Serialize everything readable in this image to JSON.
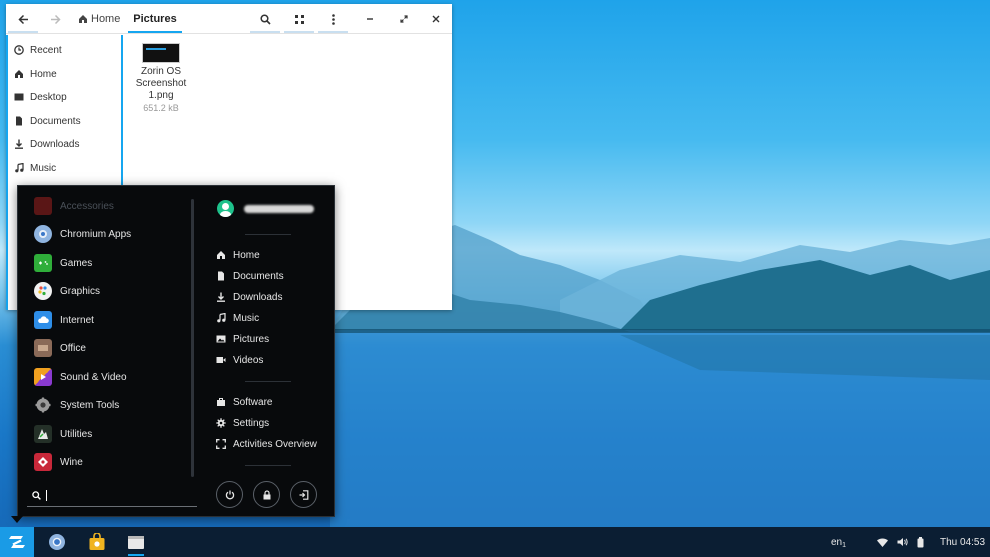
{
  "file_manager": {
    "breadcrumb": {
      "home": "Home",
      "current": "Pictures"
    },
    "sidebar": [
      {
        "label": "Recent",
        "icon": "clock-icon"
      },
      {
        "label": "Home",
        "icon": "home-icon"
      },
      {
        "label": "Desktop",
        "icon": "desktop-icon"
      },
      {
        "label": "Documents",
        "icon": "document-icon"
      },
      {
        "label": "Downloads",
        "icon": "download-icon"
      },
      {
        "label": "Music",
        "icon": "music-icon"
      }
    ],
    "file": {
      "name_line1": "Zorin OS",
      "name_line2": "Screenshot",
      "name_line3": "1.png",
      "size": "651.2 kB"
    }
  },
  "menu": {
    "categories": [
      {
        "label": "Accessories",
        "icon": "accessories-icon",
        "color": "#b02a2a"
      },
      {
        "label": "Chromium Apps",
        "icon": "chromium-icon",
        "color": "#8fb4e0"
      },
      {
        "label": "Games",
        "icon": "games-icon",
        "color": "#2fae3a"
      },
      {
        "label": "Graphics",
        "icon": "graphics-icon",
        "color": "#f2f2f2"
      },
      {
        "label": "Internet",
        "icon": "internet-icon",
        "color": "#2e8ee8"
      },
      {
        "label": "Office",
        "icon": "office-icon",
        "color": "#8a6a58"
      },
      {
        "label": "Sound & Video",
        "icon": "sound-video-icon",
        "color": "#f0a020"
      },
      {
        "label": "System Tools",
        "icon": "system-tools-icon",
        "color": "#9a9a9a"
      },
      {
        "label": "Utilities",
        "icon": "utilities-icon",
        "color": "#3a4a40"
      },
      {
        "label": "Wine",
        "icon": "wine-icon",
        "color": "#c8283a"
      }
    ],
    "places": [
      {
        "label": "Home",
        "icon": "home-icon"
      },
      {
        "label": "Documents",
        "icon": "document-icon"
      },
      {
        "label": "Downloads",
        "icon": "download-icon"
      },
      {
        "label": "Music",
        "icon": "music-icon"
      },
      {
        "label": "Pictures",
        "icon": "picture-icon"
      },
      {
        "label": "Videos",
        "icon": "video-icon"
      }
    ],
    "system": [
      {
        "label": "Software",
        "icon": "software-icon"
      },
      {
        "label": "Settings",
        "icon": "settings-icon"
      },
      {
        "label": "Activities Overview",
        "icon": "activities-icon"
      }
    ]
  },
  "taskbar": {
    "keyboard_layout": "en",
    "keyboard_layout_sub": "1",
    "clock": "Thu 04:53"
  },
  "colors": {
    "accent": "#15a6f0",
    "menu_bg": "#080a0c",
    "taskbar_bg": "#0b1e33"
  }
}
